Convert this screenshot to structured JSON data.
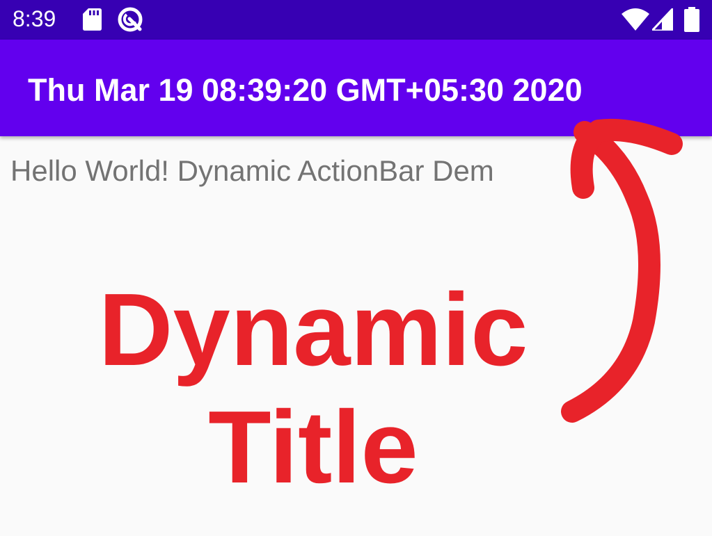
{
  "status_bar": {
    "time": "8:39",
    "icons": [
      "sd-card-icon",
      "q-icon",
      "wifi-icon",
      "signal-icon",
      "battery-icon"
    ],
    "background": "#3700b3"
  },
  "action_bar": {
    "title": "Thu Mar 19 08:39:20 GMT+05:30 2020",
    "background": "#6200ee"
  },
  "content": {
    "text": "Hello World! Dynamic ActionBar Dem"
  },
  "annotation": {
    "line1": "Dynamic",
    "line2": "Title",
    "color": "#e8232a",
    "icon": "curved-arrow-icon"
  }
}
